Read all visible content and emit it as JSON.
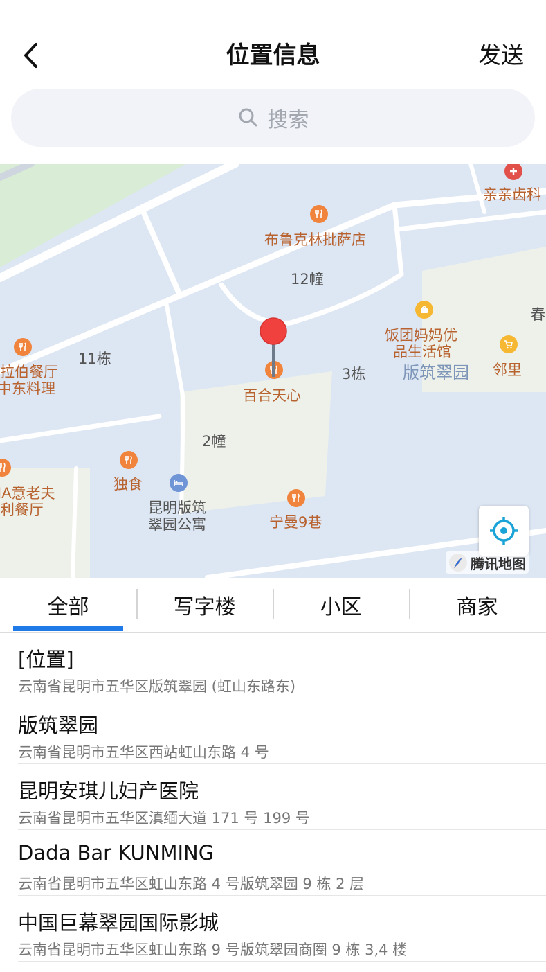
{
  "header": {
    "title": "位置信息",
    "send_label": "发送"
  },
  "search": {
    "placeholder": "搜索"
  },
  "map": {
    "labels": {
      "pizza": "布鲁克林批萨店",
      "b12": "12幢",
      "fantuan": "饭团妈妈优",
      "fantuan2": "品生活馆",
      "banzhu": "版筑翠园",
      "linli": "邻里",
      "chun": "春",
      "dental": "亲亲齿科",
      "b11": "11栋",
      "arab1": "拉伯餐厅",
      "arab2": "中东料理",
      "baihe": "百合天心",
      "b3": "3栋",
      "b2": "2幢",
      "dushi": "独食",
      "apt1": "昆明版筑",
      "apt2": "翠园公寓",
      "ningman": "宁曼9巷",
      "ital1": "IA意老夫",
      "ital2": "利餐厅"
    },
    "brand": "腾讯地图"
  },
  "tabs": [
    {
      "label": "全部"
    },
    {
      "label": "写字楼"
    },
    {
      "label": "小区"
    },
    {
      "label": "商家"
    }
  ],
  "results": [
    {
      "name": "[位置]",
      "address": "云南省昆明市五华区版筑翠园 (虹山东路东)"
    },
    {
      "name": "版筑翠园",
      "address": "云南省昆明市五华区西站虹山东路 4 号"
    },
    {
      "name": "昆明安琪儿妇产医院",
      "address": "云南省昆明市五华区滇缅大道 171 号 199 号"
    },
    {
      "name": "Dada Bar KUNMING",
      "address": "云南省昆明市五华区虹山东路 4 号版筑翠园 9 栋 2 层"
    },
    {
      "name": "中国巨幕翠园国际影城",
      "address": "云南省昆明市五华区虹山东路 9 号版筑翠园商圈 9 栋 3,4 楼"
    }
  ],
  "colors": {
    "accent": "#1f7ae8",
    "pin": "#f0413f",
    "poi": "#f0843c"
  }
}
